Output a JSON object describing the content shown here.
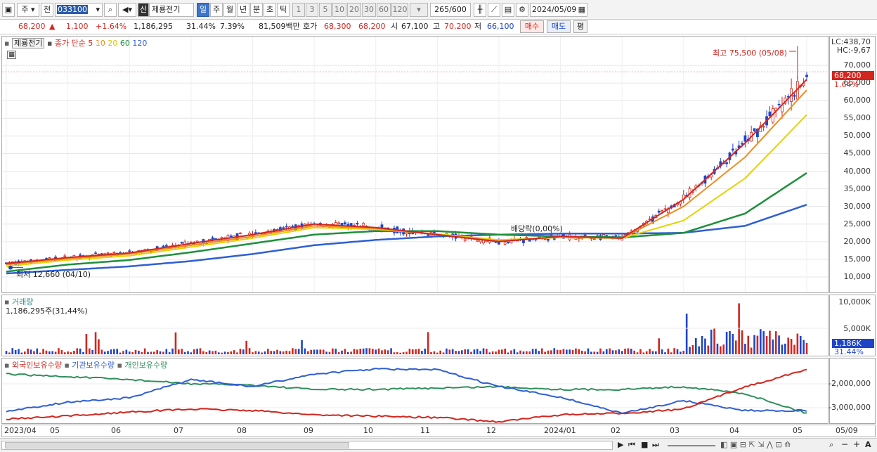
{
  "toolbar": {
    "period_select": "주",
    "prev_label": "전",
    "code": "033100",
    "sin_badge": "신",
    "stock_name": "제룡전기",
    "periods": [
      "일",
      "주",
      "월",
      "년",
      "분",
      "초",
      "틱"
    ],
    "active_period": "일",
    "intervals": [
      "1",
      "3",
      "5",
      "10",
      "20",
      "30",
      "60",
      "120"
    ],
    "count_value": "265",
    "count_total": "/600",
    "date_value": "2024/05/09"
  },
  "quote": {
    "price": "68,200",
    "change_arrow": "▲",
    "change": "1,100",
    "change_pct": "+1.64%",
    "volume": "1,186,295",
    "turnover_ratio": "31.44%",
    "vol_pct": "7.39%",
    "amount": "81,509백만",
    "ask_label": "호가",
    "ask": "68,300",
    "bid": "68,200",
    "open_label": "시",
    "open": "67,100",
    "high_label": "고",
    "high": "70,200",
    "low_label": "저",
    "low": "66,100",
    "buy_button": "매수",
    "sell_button": "매도",
    "eval_button": "평"
  },
  "price_panel": {
    "name_tag": "제룡전기",
    "ma_label": "종가 단순",
    "ma_periods": [
      "5",
      "10",
      "20",
      "60",
      "120"
    ],
    "ma_colors": [
      "#d2261e",
      "#f08c1e",
      "#e6d200",
      "#1f8f3c",
      "#2f5fd4"
    ],
    "high_annotation": "최고 75,500 (05/08)",
    "low_annotation": "최저 12,660 (04/10)",
    "dividend_annotation": "배당락(0,00%)",
    "lc": "LC:438,70",
    "hc": "HC:-9,67",
    "current_price_tag": "68,200",
    "current_pct_tag": "1.64%",
    "y_ticks": [
      "70,000",
      "65,000",
      "60,000",
      "55,000",
      "50,000",
      "45,000",
      "40,000",
      "35,000",
      "30,000",
      "25,000",
      "20,000",
      "15,000",
      "10,000"
    ]
  },
  "volume_panel": {
    "title": "거래량",
    "value_text": "1,186,295주(31,44%)",
    "y_ticks": [
      "10,000K",
      "5,000K"
    ],
    "current_tag": "1,186K",
    "current_pct": "31.44%"
  },
  "holding_panel": {
    "foreign_label": "외국인보유수량",
    "institution_label": "기관보유수량",
    "individual_label": "개인보유수량",
    "y_ticks": [
      "-2,000,000",
      "-3,000,000"
    ]
  },
  "x_axis": [
    "2023/04",
    "05",
    "06",
    "07",
    "08",
    "09",
    "10",
    "11",
    "12",
    "2024/01",
    "02",
    "03",
    "04",
    "05",
    "05/09"
  ],
  "colors": {
    "up": "#d2261e",
    "down": "#1f45c7",
    "foreign": "#d2261e",
    "institution": "#2f5fd4",
    "individual": "#2f8f5c"
  },
  "chart_data": {
    "type": "line",
    "title": "",
    "x": [
      "2023/04",
      "05",
      "06",
      "07",
      "08",
      "09",
      "10",
      "11",
      "12",
      "2024/01",
      "02",
      "03",
      "04",
      "05"
    ],
    "series": [
      {
        "name": "5",
        "values": [
          13800,
          15500,
          16800,
          19500,
          22000,
          25000,
          24000,
          22000,
          20000,
          21500,
          21000,
          32000,
          48000,
          66000
        ]
      },
      {
        "name": "10",
        "values": [
          13500,
          15200,
          16500,
          19000,
          21500,
          24500,
          23800,
          22000,
          20200,
          21300,
          21000,
          30000,
          44000,
          63000
        ]
      },
      {
        "name": "20",
        "values": [
          13000,
          14800,
          16000,
          18500,
          21000,
          24000,
          23500,
          22200,
          20500,
          21200,
          21000,
          26000,
          38000,
          56000
        ]
      },
      {
        "name": "60",
        "values": [
          11500,
          13500,
          14800,
          17000,
          19500,
          22000,
          23000,
          23000,
          22000,
          21500,
          21200,
          22500,
          28000,
          39500
        ]
      },
      {
        "name": "120",
        "values": [
          11000,
          12000,
          13000,
          14500,
          16500,
          19000,
          20500,
          21500,
          22000,
          22300,
          22300,
          22500,
          24500,
          30500
        ]
      }
    ],
    "ylim": [
      8000,
      75000
    ],
    "annotations": {
      "high": 75500,
      "low": 12660,
      "last": 68200
    }
  }
}
